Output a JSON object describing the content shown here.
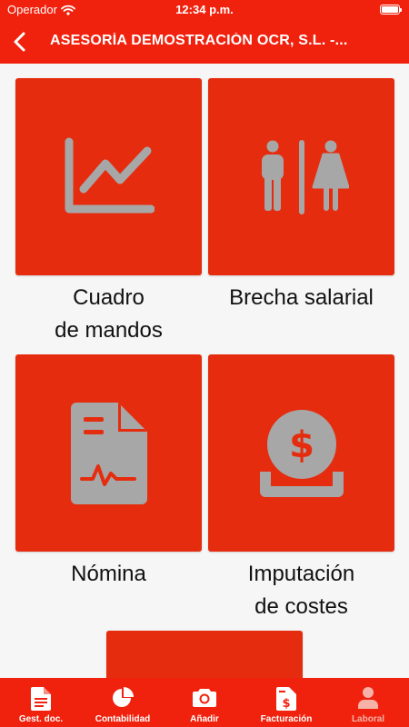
{
  "status_bar": {
    "carrier": "Operador",
    "time": "12:34 p.m."
  },
  "header": {
    "title": "ASESORÍA DEMOSTRACIÓN OCR, S.L. -..."
  },
  "tiles": [
    {
      "label_line1": "Cuadro",
      "label_line2": "de mandos",
      "icon": "line-chart-icon"
    },
    {
      "label_line1": "Brecha salarial",
      "label_line2": "",
      "icon": "man-woman-icon"
    },
    {
      "label_line1": "Nómina",
      "label_line2": "",
      "icon": "payslip-document-icon"
    },
    {
      "label_line1": "Imputación",
      "label_line2": "de costes",
      "icon": "coin-in-hand-icon"
    }
  ],
  "tabbar": {
    "items": [
      {
        "label": "Gest. doc.",
        "icon": "document-icon"
      },
      {
        "label": "Contabilidad",
        "icon": "pie-chart-icon"
      },
      {
        "label": "Añadir",
        "icon": "camera-icon"
      },
      {
        "label": "Facturación",
        "icon": "invoice-dollar-icon"
      },
      {
        "label": "Laboral",
        "icon": "person-icon",
        "active": true
      }
    ]
  },
  "colors": {
    "brand_red": "#f0220e",
    "tile_red": "#e52c0e",
    "icon_gray": "#a7a7a7",
    "background": "#f6f6f6"
  }
}
